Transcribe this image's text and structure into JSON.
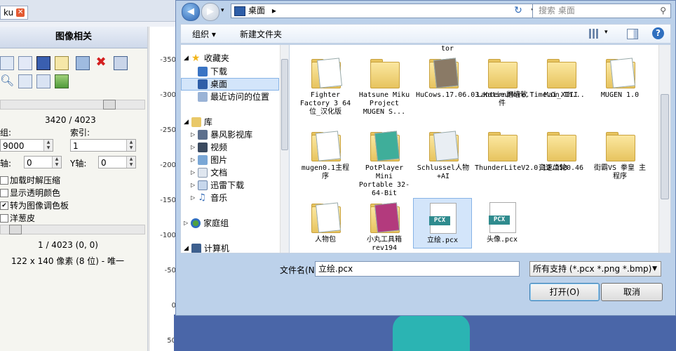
{
  "left_app": {
    "tab_label": "ku",
    "panel_title": "图像相关",
    "count_text": "3420 / 4023",
    "group_label": "组:",
    "index_label": "索引:",
    "group_value": "9000",
    "index_value": "1",
    "x_axis_label": "轴:",
    "y_axis_label": "Y轴:",
    "x_axis_value": "0",
    "y_axis_value": "0",
    "checkboxes": [
      {
        "label": "加载时解压缩",
        "checked": false
      },
      {
        "label": "显示透明颜色",
        "checked": false
      },
      {
        "label": "转为图像调色板",
        "checked": true
      },
      {
        "label": "洋葱皮",
        "checked": false
      }
    ],
    "frame_text": "1 / 4023 (0, 0)",
    "size_text": "122 x 140 像素 (8 位) - 唯一",
    "ruler_ticks": [
      "-350",
      "-300",
      "-250",
      "-200",
      "-150",
      "-100",
      "-50",
      "0",
      "50"
    ]
  },
  "dialog": {
    "address_path": "桌面",
    "address_arrow": "▸",
    "search_placeholder": "搜索 桌面",
    "toolbar": {
      "organize": "组织 ▾",
      "new_folder": "新建文件夹"
    },
    "tree": [
      {
        "label": "收藏夹",
        "icon": "star-icon",
        "level": 0
      },
      {
        "label": "下载",
        "icon": "download-folder-icon",
        "level": 1
      },
      {
        "label": "桌面",
        "icon": "desktop-icon",
        "level": 1,
        "selected": true
      },
      {
        "label": "最近访问的位置",
        "icon": "recent-places-icon",
        "level": 1
      },
      {
        "label": "库",
        "icon": "library-icon",
        "level": 0
      },
      {
        "label": "暴风影视库",
        "icon": "video-library-icon",
        "level": 1
      },
      {
        "label": "视频",
        "icon": "video-icon",
        "level": 1
      },
      {
        "label": "图片",
        "icon": "picture-icon",
        "level": 1
      },
      {
        "label": "文档",
        "icon": "document-icon",
        "level": 1
      },
      {
        "label": "迅雷下载",
        "icon": "thunder-download-icon",
        "level": 1
      },
      {
        "label": "音乐",
        "icon": "music-icon",
        "level": 1
      },
      {
        "label": "家庭组",
        "icon": "homegroup-icon",
        "level": 0
      },
      {
        "label": "计算机",
        "icon": "computer-icon",
        "level": 0
      }
    ],
    "top_partial": "tor",
    "files": [
      {
        "name": "Fighter Factory 3 64位_汉化版",
        "kind": "folder"
      },
      {
        "name": "Hatsune Miku Project MUGEN S...",
        "kind": "folder"
      },
      {
        "name": "HuCows.17.06.03.Katie.More.Time.On.Th...",
        "kind": "folder"
      },
      {
        "name": "Lantern翻墙软件",
        "kind": "folder"
      },
      {
        "name": "Mai_XIII",
        "kind": "folder"
      },
      {
        "name": "MUGEN 1.0",
        "kind": "folder"
      },
      {
        "name": "mugen0.1主程序",
        "kind": "folder"
      },
      {
        "name": "PotPlayer Mini Portable 32-64-Bit",
        "kind": "folder"
      },
      {
        "name": "Schlussel人物+AI",
        "kind": "folder"
      },
      {
        "name": "ThunderLiteV2.0.12.258",
        "kind": "folder"
      },
      {
        "name": "变速齿轮0.46",
        "kind": "folder"
      },
      {
        "name": "街霸VS 拳皇 主程序",
        "kind": "folder"
      },
      {
        "name": "人物包",
        "kind": "folder"
      },
      {
        "name": "小丸工具箱rev194",
        "kind": "folder"
      },
      {
        "name": "立绘.pcx",
        "kind": "pcx",
        "selected": true
      },
      {
        "name": "头像.pcx",
        "kind": "pcx"
      }
    ],
    "pcx_tag": "PCX",
    "filename_label": "文件名(N):",
    "filename_value": "立绘.pcx",
    "filetype_value": "所有支持 (*.pcx *.png *.bmp)",
    "open_button": "打开(O)",
    "cancel_button": "取消"
  }
}
